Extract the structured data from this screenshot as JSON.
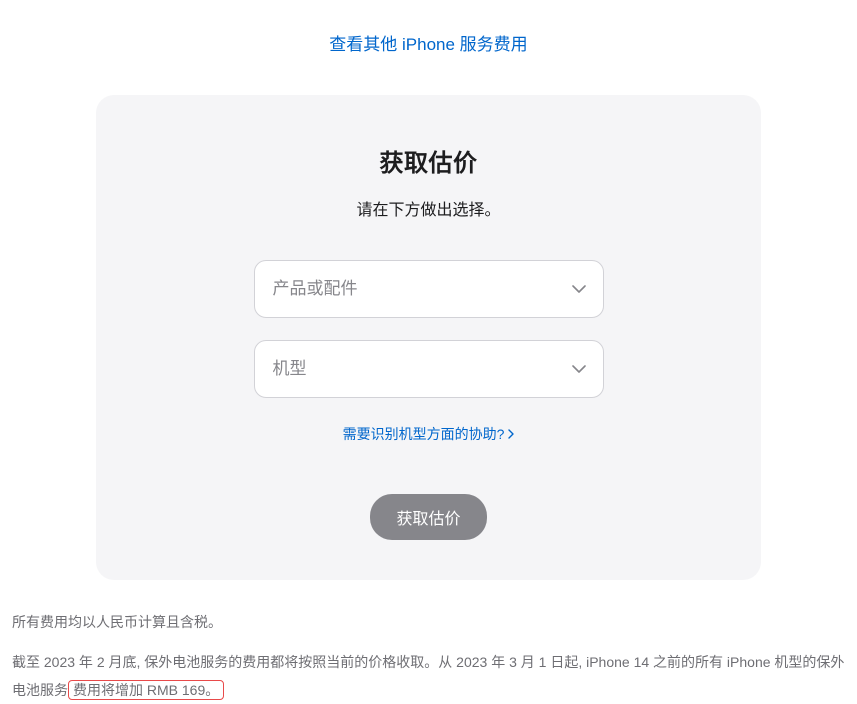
{
  "top_link": {
    "label": "查看其他 iPhone 服务费用"
  },
  "card": {
    "title": "获取估价",
    "subtitle": "请在下方做出选择。",
    "select_product_placeholder": "产品或配件",
    "select_model_placeholder": "机型",
    "help_link_label": "需要识别机型方面的协助?",
    "submit_label": "获取估价"
  },
  "footnote": {
    "line1": "所有费用均以人民币计算且含税。",
    "line2_pre": "截至 2023 年 2 月底, 保外电池服务的费用都将按照当前的价格收取。从 2023 年 3 月 1 日起, iPhone 14 之前的所有 iPhone 机型的保外电池服务",
    "line2_highlight": "费用将增加 RMB 169。"
  }
}
